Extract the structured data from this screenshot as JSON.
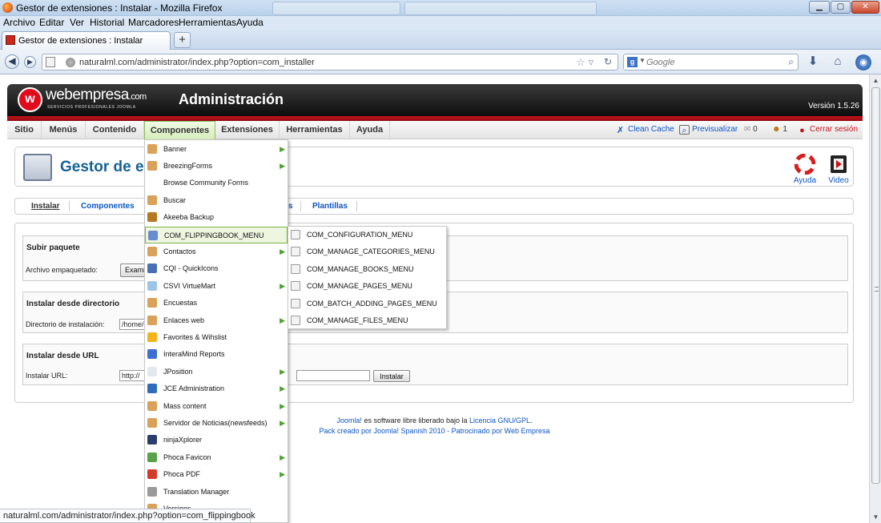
{
  "window": {
    "title": "Gestor de extensiones : Instalar - Mozilla Firefox",
    "controls": [
      "minimize",
      "maximize",
      "close"
    ]
  },
  "menubar": [
    "Archivo",
    "Editar",
    "Ver",
    "Historial",
    "Marcadores",
    "Herramientas",
    "Ayuda"
  ],
  "tab": {
    "label": "Gestor de extensiones : Instalar"
  },
  "url": "naturalml.com/administrator/index.php?option=com_installer",
  "search": {
    "engine_icon": "google-icon",
    "placeholder": "Google"
  },
  "header": {
    "logo_text": "webempresa",
    "logo_suffix": ".com",
    "logo_tagline": "SERVICIOS PROFESIONALES JOOMLA",
    "title": "Administración",
    "version": "Versión 1.5.26"
  },
  "admin_menu": [
    "Sitio",
    "Menús",
    "Contenido",
    "Componentes",
    "Extensiones",
    "Herramientas",
    "Ayuda"
  ],
  "admin_right": {
    "clean_cache": "Clean Cache",
    "preview": "Previsualizar",
    "count1": "0",
    "count2": "1",
    "logout": "Cerrar sesión"
  },
  "toolbar": {
    "page_title": "Gestor de e",
    "help": "Ayuda",
    "video": "Video"
  },
  "subtabs": [
    "Instalar",
    "Componentes",
    "Plantillas"
  ],
  "sections": {
    "upload": {
      "title": "Subir paquete",
      "label": "Archivo empaquetado:",
      "button": "Examin"
    },
    "directory": {
      "title": "Instalar desde directorio",
      "label": "Directorio de instalación:",
      "value": "/home/na"
    },
    "url": {
      "title": "Instalar desde URL",
      "label": "Instalar URL:",
      "value": "http://",
      "button": "Instalar"
    }
  },
  "footer": {
    "line1_a": "Joomla!",
    "line1_b": " es software libre liberado bajo la ",
    "line1_c": "Licencia GNU/GPL",
    "line1_d": ".",
    "line2": "Pack creado por Joomla! Spanish 2010 - Patrocinado por Web Empresa"
  },
  "dropdown": [
    {
      "label": "Banner",
      "has_sub": true
    },
    {
      "label": "BreezingForms",
      "has_sub": true
    },
    {
      "label": "Browse Community Forms",
      "has_sub": false
    },
    {
      "label": "Buscar",
      "has_sub": false
    },
    {
      "label": "Akeeba Backup",
      "has_sub": false
    },
    {
      "label": "COM_FLIPPINGBOOK_MENU",
      "has_sub": false,
      "highlighted": true
    },
    {
      "label": "Contactos",
      "has_sub": true
    },
    {
      "label": "CQI - QuickIcons",
      "has_sub": false
    },
    {
      "label": "CSVI VirtueMart",
      "has_sub": true
    },
    {
      "label": "Encuestas",
      "has_sub": false
    },
    {
      "label": "Enlaces web",
      "has_sub": true
    },
    {
      "label": "Favorites & Wihslist",
      "has_sub": false
    },
    {
      "label": "InteraMind Reports",
      "has_sub": false
    },
    {
      "label": "JPosition",
      "has_sub": true
    },
    {
      "label": "JCE Administration",
      "has_sub": true
    },
    {
      "label": "Mass content",
      "has_sub": true
    },
    {
      "label": "Servidor de Noticias(newsfeeds)",
      "has_sub": true
    },
    {
      "label": "ninjaXplorer",
      "has_sub": false
    },
    {
      "label": "Phoca Favicon",
      "has_sub": true
    },
    {
      "label": "Phoca PDF",
      "has_sub": true
    },
    {
      "label": "Translation Manager",
      "has_sub": false
    },
    {
      "label": "Versions",
      "has_sub": false
    }
  ],
  "submenu": [
    "COM_CONFIGURATION_MENU",
    "COM_MANAGE_CATEGORIES_MENU",
    "COM_MANAGE_BOOKS_MENU",
    "COM_MANAGE_PAGES_MENU",
    "COM_BATCH_ADDING_PAGES_MENU",
    "COM_MANAGE_FILES_MENU"
  ],
  "status": "naturalml.com/administrator/index.php?option=com_flippingbook",
  "colors": {
    "accent_red": "#c8121b",
    "link_blue": "#0b55c4",
    "title_blue": "#146295",
    "menu_green": "#8cbf5f"
  }
}
